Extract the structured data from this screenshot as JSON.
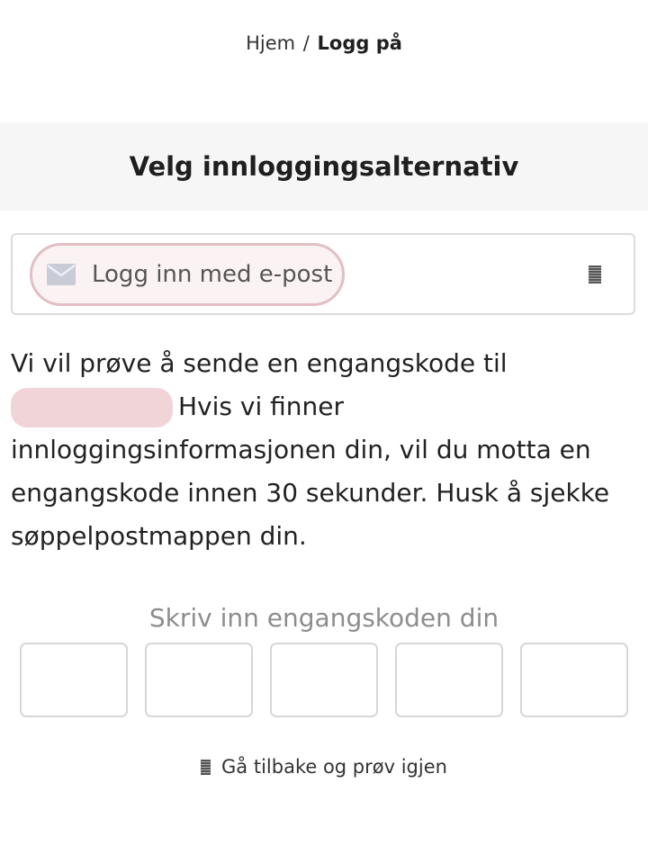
{
  "breadcrumb": {
    "home": "Hjem",
    "separator": "/",
    "current": "Logg på"
  },
  "header": {
    "title": "Velg innloggingsalternativ"
  },
  "login_options": {
    "email_option_label": "Logg inn med e-post",
    "email_icon": "mail-icon",
    "accent_border": "#e2bfc4"
  },
  "info": {
    "text_before": "Vi vil prøve å sende en engangskode til",
    "text_after": "Hvis vi finner innloggingsinformasjonen din, vil du motta en engangskode innen 30 sekunder. Husk å sjekke søppelpostmappen din."
  },
  "otp": {
    "title": "Skriv inn engangskoden din",
    "boxes": [
      "",
      "",
      "",
      "",
      ""
    ]
  },
  "back": {
    "label": "Gå tilbake og prøv igjen"
  },
  "colors": {
    "redaction": "#f1d4d8",
    "pill_background": "#fbf2f3",
    "title_band": "#f6f6f6"
  }
}
